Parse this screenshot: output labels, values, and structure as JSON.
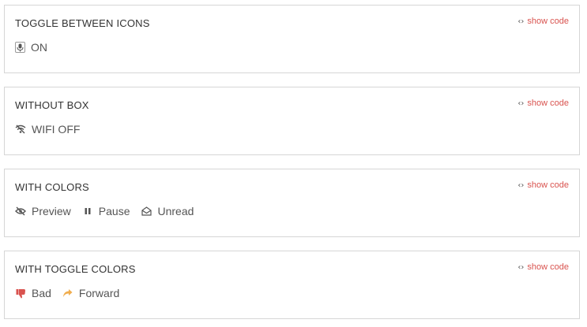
{
  "panels": [
    {
      "title": "TOGGLE BETWEEN ICONS",
      "show_code": "show code",
      "items": [
        {
          "label": "ON",
          "icon": "microphone-icon"
        }
      ]
    },
    {
      "title": "WITHOUT BOX",
      "show_code": "show code",
      "items": [
        {
          "label": "WIFI OFF",
          "icon": "wifi-off-icon"
        }
      ]
    },
    {
      "title": "WITH COLORS",
      "show_code": "show code",
      "items": [
        {
          "label": "Preview",
          "icon": "eye-slash-icon"
        },
        {
          "label": "Pause",
          "icon": "pause-icon"
        },
        {
          "label": "Unread",
          "icon": "envelope-open-icon"
        }
      ]
    },
    {
      "title": "WITH TOGGLE COLORS",
      "show_code": "show code",
      "items": [
        {
          "label": "Bad",
          "icon": "thumbs-down-icon",
          "color": "#d9534f"
        },
        {
          "label": "Forward",
          "icon": "share-arrow-icon",
          "color": "#f0ad4e"
        }
      ]
    }
  ],
  "colors": {
    "link": "#d9534f",
    "border": "#d6d6d6",
    "bad": "#d9534f",
    "forward": "#f0ad4e"
  }
}
